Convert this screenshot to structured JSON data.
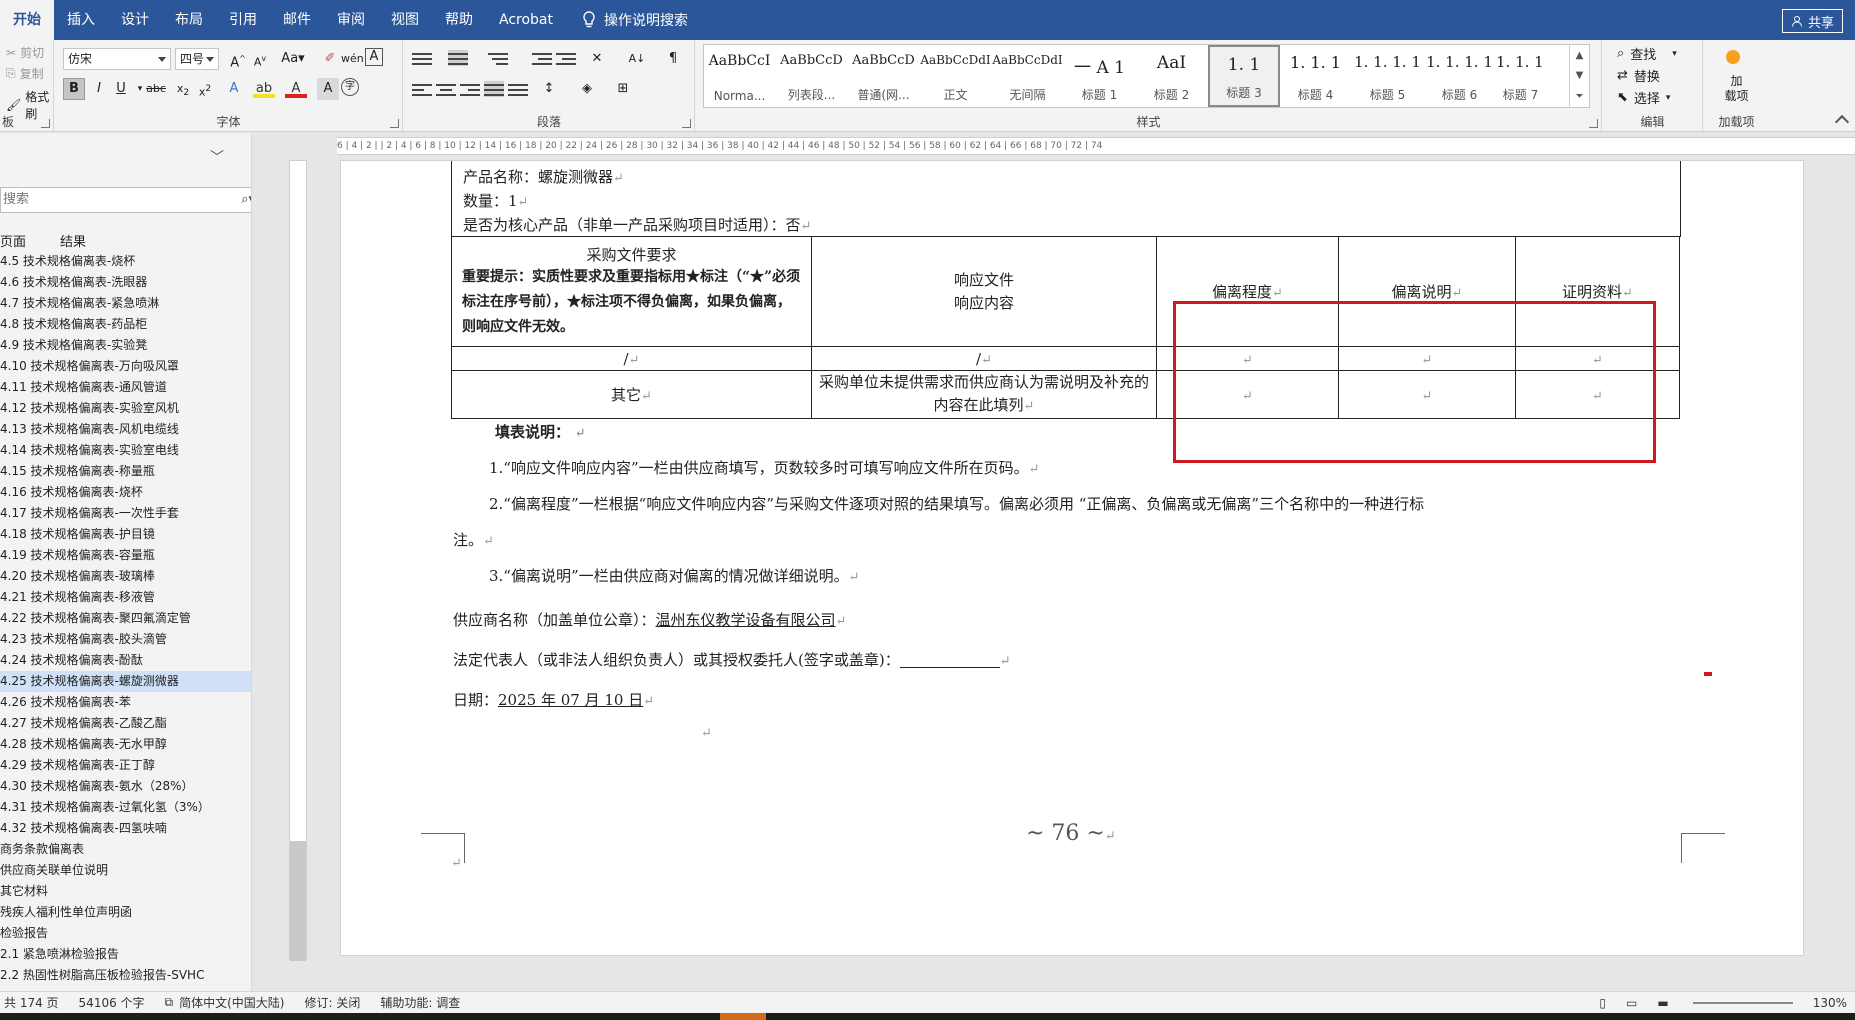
{
  "ribbon_tabs": [
    "开始",
    "插入",
    "设计",
    "布局",
    "引用",
    "邮件",
    "审阅",
    "视图",
    "帮助",
    "Acrobat"
  ],
  "tell_me": "操作说明搜索",
  "share": "共享",
  "clipboard": {
    "cut": "剪切",
    "copy": "复制",
    "painter": "格式刷",
    "label": "板"
  },
  "font": {
    "name": "仿宋",
    "size": "四号",
    "label": "字体"
  },
  "paragraph": {
    "label": "段落"
  },
  "styles": {
    "label": "样式",
    "items": [
      {
        "preview": "AaBbCcI",
        "name": "Norma..."
      },
      {
        "preview": "AaBbCcD",
        "name": "列表段..."
      },
      {
        "preview": "AaBbCcD",
        "name": "普通(网..."
      },
      {
        "preview": "AaBbCcDdI",
        "name": "正文"
      },
      {
        "preview": "AaBbCcDdI",
        "name": "无间隔"
      },
      {
        "preview": "一 A 1",
        "name": "标题 1"
      },
      {
        "preview": "AaI",
        "name": "标题 2"
      },
      {
        "preview": "1. 1",
        "name": "标题 3"
      },
      {
        "preview": "1. 1. 1",
        "name": "标题 4"
      },
      {
        "preview": "1. 1. 1. 1",
        "name": "标题 5"
      },
      {
        "preview": "1. 1. 1. 1",
        "name": "标题 6"
      },
      {
        "preview": "1. 1. 1. 1",
        "name": "标题 7"
      }
    ]
  },
  "editing": {
    "find": "查找",
    "replace": "替换",
    "select": "选择",
    "label": "编辑"
  },
  "addins": {
    "label1": "加",
    "label2": "载项",
    "group": "加载项"
  },
  "nav": {
    "search_placeholder": "搜索",
    "tabs": [
      "页面",
      "结果"
    ],
    "items": [
      "4.5 技术规格偏离表-烧杯",
      "4.6 技术规格偏离表-洗眼器",
      "4.7 技术规格偏离表-紧急喷淋",
      "4.8 技术规格偏离表-药品柜",
      "4.9 技术规格偏离表-实验凳",
      "4.10 技术规格偏离表-万向吸风罩",
      "4.11 技术规格偏离表-通风管道",
      "4.12 技术规格偏离表-实验室风机",
      "4.13 技术规格偏离表-风机电缆线",
      "4.14 技术规格偏离表-实验室电线",
      "4.15 技术规格偏离表-称量瓶",
      "4.16 技术规格偏离表-烧杯",
      "4.17 技术规格偏离表-一次性手套",
      "4.18 技术规格偏离表-护目镜",
      "4.19 技术规格偏离表-容量瓶",
      "4.20 技术规格偏离表-玻璃棒",
      "4.21 技术规格偏离表-移液管",
      "4.22 技术规格偏离表-聚四氟滴定管",
      "4.23 技术规格偏离表-胶头滴管",
      "4.24 技术规格偏离表-酚酞",
      "4.25 技术规格偏离表-螺旋测微器",
      "4.26 技术规格偏离表-苯",
      "4.27 技术规格偏离表-乙酸乙酯",
      "4.28 技术规格偏离表-无水甲醇",
      "4.29 技术规格偏离表-正丁醇",
      "4.30 技术规格偏离表-氨水（28%）",
      "4.31 技术规格偏离表-过氧化氢（3%）",
      "4.32 技术规格偏离表-四氢呋喃",
      "商务条款偏离表",
      "供应商关联单位说明",
      "其它材料",
      "残疾人福利性单位声明函",
      "检验报告",
      "2.1 紧急喷淋检验报告",
      "2.2 热固性树脂高压板检验报告-SVHC"
    ],
    "selected_index": 20
  },
  "ruler_numbers": "6 | 4 | 2 | | 2 | 4 | 6 | 8 | 10 | 12 | 14 | 16 | 18 | 20 | 22 | 24 | 26 | 28 | 30 | 32 | 34 | 36 | 38 | 40 | 42 | 44 | 46 | 48 | 50 | 52 | 54 | 56 | 58 | 60 | 62 | 64 | 66 | 68 | 70 | 72 | 74",
  "document": {
    "product_line": "产品名称：螺旋测微器",
    "qty_line": "数量：1",
    "core_line": "是否为核心产品（非单一产品采购项目时适用）：否",
    "table": {
      "h_req": "采购文件要求",
      "h_req_note": "重要提示：实质性要求及重要指标用★标注（“★”必须标注在序号前），★标注项不得负偏离，如果负偏离，则响应文件无效。",
      "h_resp1": "响应文件",
      "h_resp2": "响应内容",
      "h_dev": "偏离程度",
      "h_desc": "偏离说明",
      "h_proof": "证明资料",
      "row1_a": "/",
      "row1_b": "/",
      "row2_a": "其它",
      "row2_b": "采购单位未提供需求而供应商认为需说明及补充的内容在此填列"
    },
    "fill_title": "填表说明：",
    "note1": "1.“响应文件响应内容”一栏由供应商填写，页数较多时可填写响应文件所在页码。",
    "note2": "2.“偏离程度”一栏根据“响应文件响应内容”与采购文件逐项对照的结果填写。偏离必须用 “正偏离、负偏离或无偏离”三个名称中的一种进行标",
    "note2_cont": "注。",
    "note3": "3.“偏离说明”一栏由供应商对偏离的情况做详细说明。",
    "supplier_label": "供应商名称（加盖单位公章）：",
    "supplier_name": "温州东仪教学设备有限公司",
    "rep_line": "法定代表人（或非法人组织负责人）或其授权委托人(签字或盖章)：",
    "date_label": "日期：",
    "date_value": "2025 年 07 月 10 日",
    "page_number": "~ 76 ~"
  },
  "status": {
    "pages": "共 174 页",
    "words": "54106 个字",
    "language": "简体中文(中国大陆)",
    "track": "修订: 关闭",
    "accessibility": "辅助功能: 调查",
    "zoom": "130%"
  },
  "colors": {
    "ribbon_blue": "#2b579a",
    "highlight_red": "#d0191f",
    "nav_selected": "#cfe0f7"
  }
}
